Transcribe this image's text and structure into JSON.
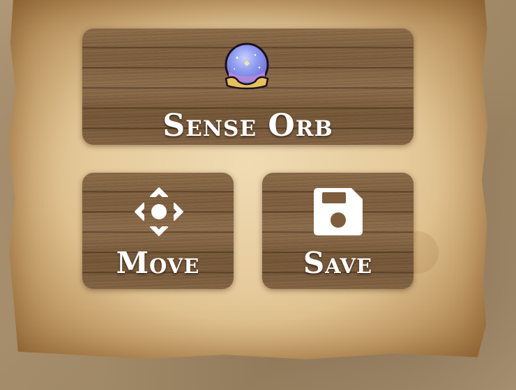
{
  "buttons": {
    "sense_orb": {
      "label": "Sense Orb",
      "icon": "crystal-orb-icon"
    },
    "move": {
      "label": "Move",
      "icon": "move-arrows-icon"
    },
    "save": {
      "label": "Save",
      "icon": "floppy-disk-icon"
    }
  },
  "colors": {
    "label": "#ffffff",
    "wood": "#7d5d3c",
    "parchment": "#e6cb9c",
    "orb": "#8f9cf0",
    "orb_base": "#e8c05a"
  }
}
